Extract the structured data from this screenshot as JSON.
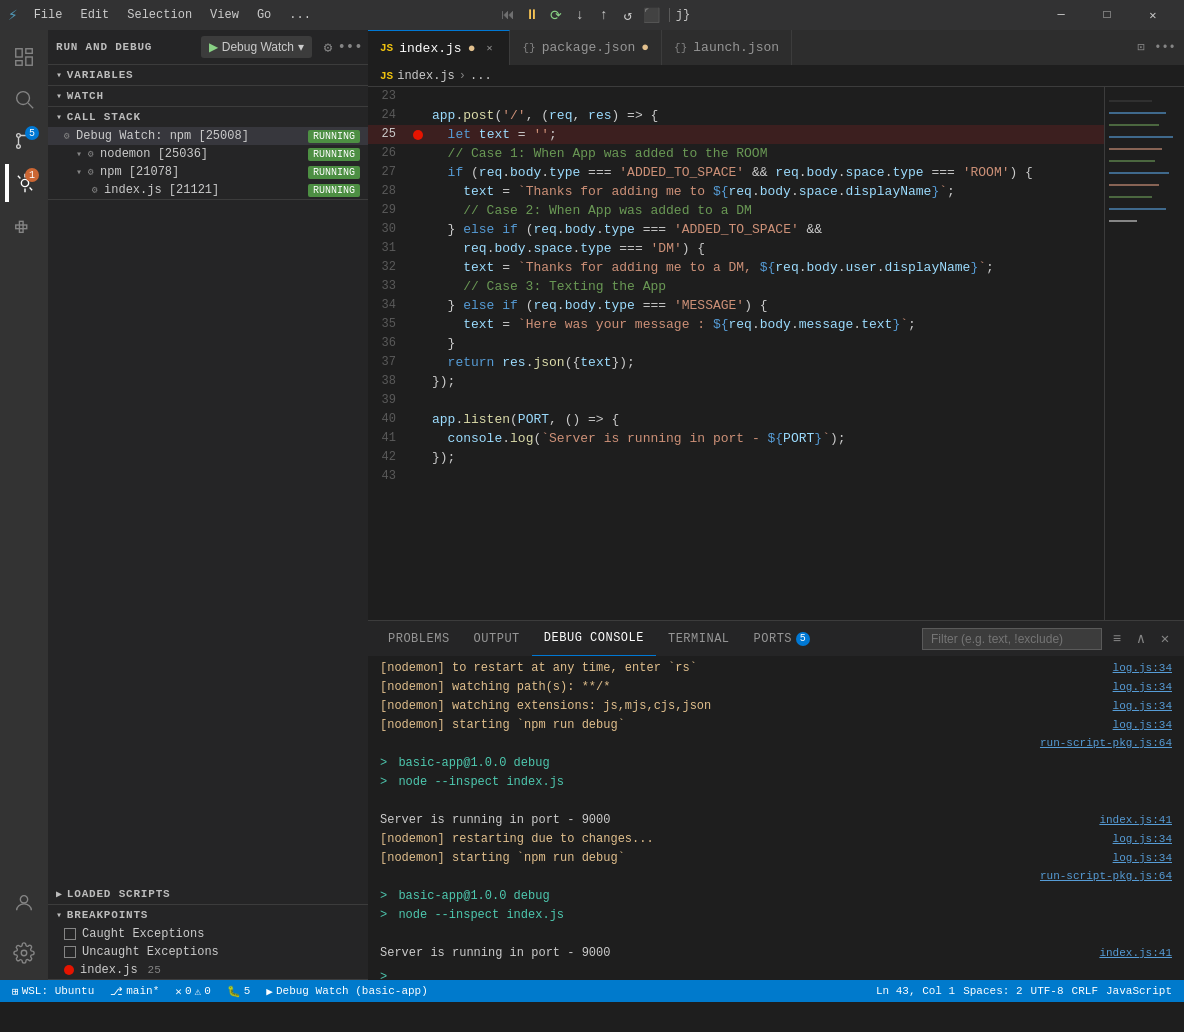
{
  "titlebar": {
    "icon": "⚡",
    "menus": [
      "File",
      "Edit",
      "Selection",
      "View",
      "Go",
      "..."
    ],
    "debug_controls": [
      "⏮",
      "⏸",
      "⟳",
      "↓",
      "↑",
      "⟲",
      "⬛",
      "→|"
    ],
    "window_controls": [
      "−",
      "▢",
      "✕"
    ]
  },
  "toolbar": {
    "run_debug_label": "RUN AND DEBUG",
    "watch_btn": "Debug Watch",
    "settings_icon": "gear",
    "more_icon": "ellipsis"
  },
  "tabs": [
    {
      "label": "index.js",
      "modified": true,
      "active": true,
      "icon": "JS"
    },
    {
      "label": "package.json",
      "modified": true,
      "active": false,
      "icon": "{}"
    },
    {
      "label": "launch.json",
      "modified": false,
      "active": false,
      "icon": "{}"
    }
  ],
  "breadcrumb": {
    "parts": [
      "index.js",
      "..."
    ]
  },
  "code": {
    "lines": [
      {
        "num": 23,
        "content": "",
        "indent": 0
      },
      {
        "num": 24,
        "content": "app.post('/', (req, res) => {",
        "breakpoint": false
      },
      {
        "num": 25,
        "content": "  let text = '';",
        "breakpoint": true
      },
      {
        "num": 26,
        "content": "  // Case 1: When App was added to the ROOM",
        "is_comment": true
      },
      {
        "num": 27,
        "content": "  if (req.body.type === 'ADDED_TO_SPACE' && req.body.space.type === 'ROOM') {",
        "breakpoint": false
      },
      {
        "num": 28,
        "content": "    text = `Thanks for adding me to ${req.body.space.displayName}`;",
        "breakpoint": false
      },
      {
        "num": 29,
        "content": "    // Case 2: When App was added to a DM",
        "is_comment": true
      },
      {
        "num": 30,
        "content": "  } else if (req.body.type === 'ADDED_TO_SPACE' &&",
        "breakpoint": false
      },
      {
        "num": 31,
        "content": "    req.body.space.type === 'DM') {",
        "breakpoint": false
      },
      {
        "num": 32,
        "content": "    text = `Thanks for adding me to a DM, ${req.body.user.displayName}`;",
        "breakpoint": false
      },
      {
        "num": 33,
        "content": "    // Case 3: Texting the App",
        "is_comment": true
      },
      {
        "num": 34,
        "content": "  } else if (req.body.type === 'MESSAGE') {",
        "breakpoint": false
      },
      {
        "num": 35,
        "content": "    text = `Here was your message : ${req.body.message.text}`;",
        "breakpoint": false
      },
      {
        "num": 36,
        "content": "  }",
        "breakpoint": false
      },
      {
        "num": 37,
        "content": "  return res.json({text});",
        "breakpoint": false
      },
      {
        "num": 38,
        "content": "});",
        "breakpoint": false
      },
      {
        "num": 39,
        "content": "",
        "breakpoint": false
      },
      {
        "num": 40,
        "content": "app.listen(PORT, () => {",
        "breakpoint": false
      },
      {
        "num": 41,
        "content": "  console.log(`Server is running in port - ${PORT}`);",
        "breakpoint": false
      },
      {
        "num": 42,
        "content": "});",
        "breakpoint": false
      },
      {
        "num": 43,
        "content": "",
        "breakpoint": false
      }
    ]
  },
  "sidebar": {
    "sections": {
      "variables": "VARIABLES",
      "watch": "WATCH",
      "call_stack": "CALL STACK",
      "loaded_scripts": "LOADED SCRIPTS",
      "breakpoints": "BREAKPOINTS"
    },
    "call_stack_items": [
      {
        "label": "Debug Watch: npm [25008]",
        "status": "RUNNING",
        "depth": 0,
        "active": true
      },
      {
        "label": "nodemon [25036]",
        "status": "RUNNING",
        "depth": 1
      },
      {
        "label": "npm [21078]",
        "status": "RUNNING",
        "depth": 1
      },
      {
        "label": "index.js [21121]",
        "status": "RUNNING",
        "depth": 2
      }
    ],
    "breakpoints": [
      {
        "label": "Caught Exceptions",
        "checked": false,
        "is_file": false
      },
      {
        "label": "Uncaught Exceptions",
        "checked": false,
        "is_file": false
      },
      {
        "label": "index.js",
        "checked": true,
        "is_file": true,
        "line": 25
      }
    ]
  },
  "panel": {
    "tabs": [
      "PROBLEMS",
      "OUTPUT",
      "DEBUG CONSOLE",
      "TERMINAL",
      "PORTS"
    ],
    "active_tab": "DEBUG CONSOLE",
    "ports_badge": "5",
    "filter_placeholder": "Filter (e.g. text, !exclude)",
    "console_lines": [
      {
        "text": "[nodemon] to restart at any time, enter `rs`",
        "source": "log.js:34",
        "color": "yellow"
      },
      {
        "text": "[nodemon] watching path(s): **/*",
        "source": "log.js:34",
        "color": "yellow"
      },
      {
        "text": "[nodemon] watching extensions: js,mjs,cjs,json",
        "source": "log.js:34",
        "color": "yellow"
      },
      {
        "text": "[nodemon] starting `npm run debug`",
        "source": "log.js:34",
        "color": "yellow"
      },
      {
        "text": "",
        "source": ""
      },
      {
        "text": "> basic-app@1.0.0 debug",
        "source": "",
        "color": "green",
        "arrow": true
      },
      {
        "text": "> node --inspect index.js",
        "source": "",
        "color": "green",
        "arrow": true
      },
      {
        "text": "",
        "source": ""
      },
      {
        "text": "Server is running in port - 9000",
        "source": "index.js:41",
        "color": "white"
      },
      {
        "text": "[nodemon] restarting due to changes...",
        "source": "log.js:34",
        "color": "yellow"
      },
      {
        "text": "[nodemon] starting `npm run debug`",
        "source": "log.js:34",
        "color": "yellow"
      },
      {
        "text": "",
        "source": "run-script-pkg.js:64"
      },
      {
        "text": "> basic-app@1.0.0 debug",
        "source": "",
        "color": "green",
        "arrow": true
      },
      {
        "text": "> node --inspect index.js",
        "source": "",
        "color": "green",
        "arrow": true
      },
      {
        "text": "",
        "source": ""
      },
      {
        "text": "Server is running in port - 9000",
        "source": "index.js:41",
        "color": "white"
      }
    ]
  },
  "statusbar": {
    "wsl": "WSL: Ubuntu",
    "branch": "main*",
    "errors": "0",
    "warnings": "0",
    "debug_instances": "5",
    "cursor": "Ln 43, Col 1",
    "spaces": "Spaces: 2",
    "encoding": "UTF-8",
    "line_ending": "CRLF",
    "language": "JavaScript",
    "debug_label": "Debug Watch (basic-app)"
  }
}
